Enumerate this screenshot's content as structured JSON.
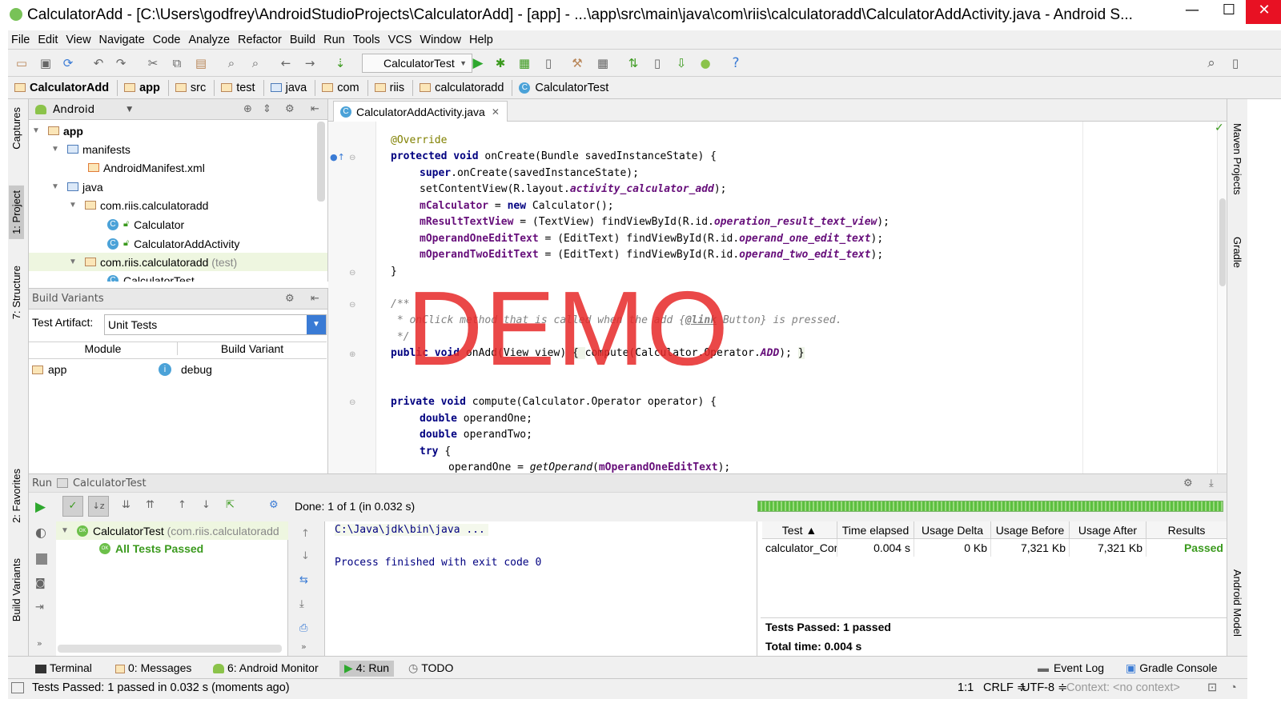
{
  "window": {
    "title": "CalculatorAdd - [C:\\Users\\godfrey\\AndroidStudioProjects\\CalculatorAdd] - [app] - ...\\app\\src\\main\\java\\com\\riis\\calculatoradd\\CalculatorAddActivity.java - Android S...",
    "min": "—",
    "max": "☐",
    "close": "✕"
  },
  "menu": [
    "File",
    "Edit",
    "View",
    "Navigate",
    "Code",
    "Analyze",
    "Refactor",
    "Build",
    "Run",
    "Tools",
    "VCS",
    "Window",
    "Help"
  ],
  "toolbar": {
    "run_config": "CalculatorTest",
    "help": "?"
  },
  "breadcrumb": [
    "CalculatorAdd",
    "app",
    "src",
    "test",
    "java",
    "com",
    "riis",
    "calculatoradd",
    "CalculatorTest"
  ],
  "left_strip": {
    "captures": "Captures",
    "project": "1: Project",
    "structure": "7: Structure",
    "favorites": "2: Favorites",
    "build_variants": "Build Variants"
  },
  "right_strip": {
    "maven": "Maven Projects",
    "gradle": "Gradle",
    "android_model": "Android Model"
  },
  "project": {
    "view_mode": "Android",
    "tree": [
      {
        "label": "app",
        "bold": true
      },
      {
        "label": "manifests"
      },
      {
        "label": "AndroidManifest.xml"
      },
      {
        "label": "java"
      },
      {
        "label": "com.riis.calculatoradd"
      },
      {
        "label": "Calculator"
      },
      {
        "label": "CalculatorAddActivity"
      },
      {
        "label": "com.riis.calculatoradd",
        "suffix": "(test)"
      },
      {
        "label": "CalculatorTest"
      }
    ]
  },
  "build_variants": {
    "title": "Build Variants",
    "artifact_label": "Test Artifact:",
    "artifact_value": "Unit Tests",
    "col_module": "Module",
    "col_variant": "Build Variant",
    "row_module": "app",
    "row_variant": "debug",
    "info": "i"
  },
  "editor": {
    "tab": "CalculatorAddActivity.java",
    "watermark": "DEMO",
    "lines": [
      "@Override",
      "protected void onCreate(Bundle savedInstanceState) {",
      "super.onCreate(savedInstanceState);",
      "setContentView(R.layout.activity_calculator_add);",
      "mCalculator = new Calculator();",
      "mResultTextView = (TextView) findViewById(R.id.operation_result_text_view);",
      "mOperandOneEditText = (EditText) findViewById(R.id.operand_one_edit_text);",
      "mOperandTwoEditText = (EditText) findViewById(R.id.operand_two_edit_text);",
      "}",
      "/**",
      " * onClick method that is called when the add {@link Button} is pressed.",
      " */",
      "public void onAdd(View view) { compute(Calculator.Operator.ADD); }",
      "private void compute(Calculator.Operator operator) {",
      "double operandOne;",
      "double operandTwo;",
      "try {",
      "operandOne = getOperand(mOperandOneEditText);"
    ]
  },
  "run": {
    "label": "Run",
    "config": "CalculatorTest",
    "status": "Done: 1 of 1 (in 0.032 s)",
    "tree_root": "CalculatorTest",
    "tree_root_pkg": "(com.riis.calculatoradd",
    "tree_child": "All Tests Passed",
    "ok": "OK",
    "console": [
      "C:\\Java\\jdk\\bin\\java ...",
      "Process finished with exit code 0"
    ],
    "table": {
      "headers": [
        "Test ▲",
        "Time elapsed",
        "Usage Delta",
        "Usage Before",
        "Usage After",
        "Results"
      ],
      "row": [
        "calculator_Corr",
        "0.004 s",
        "0 Kb",
        "7,321 Kb",
        "7,321 Kb",
        "Passed"
      ]
    },
    "summary_passed": "Tests Passed: 1 passed",
    "summary_time": "Total time: 0.004 s"
  },
  "tool_windows": {
    "terminal": "Terminal",
    "messages": "0: Messages",
    "android_monitor": "6: Android Monitor",
    "run": "4: Run",
    "todo": "TODO",
    "event_log": "Event Log",
    "gradle_console": "Gradle Console"
  },
  "status": {
    "message": "Tests Passed: 1 passed in 0.032 s (moments ago)",
    "position": "1:1",
    "line_sep": "CRLF ≑",
    "encoding": "UTF-8 ≑",
    "context": "Context: <no context>"
  },
  "colors": {
    "keyword": "#000080",
    "field": "#660e7a",
    "annotation": "#808000",
    "passed": "#3b9a1e",
    "watermark": "#e62828"
  }
}
